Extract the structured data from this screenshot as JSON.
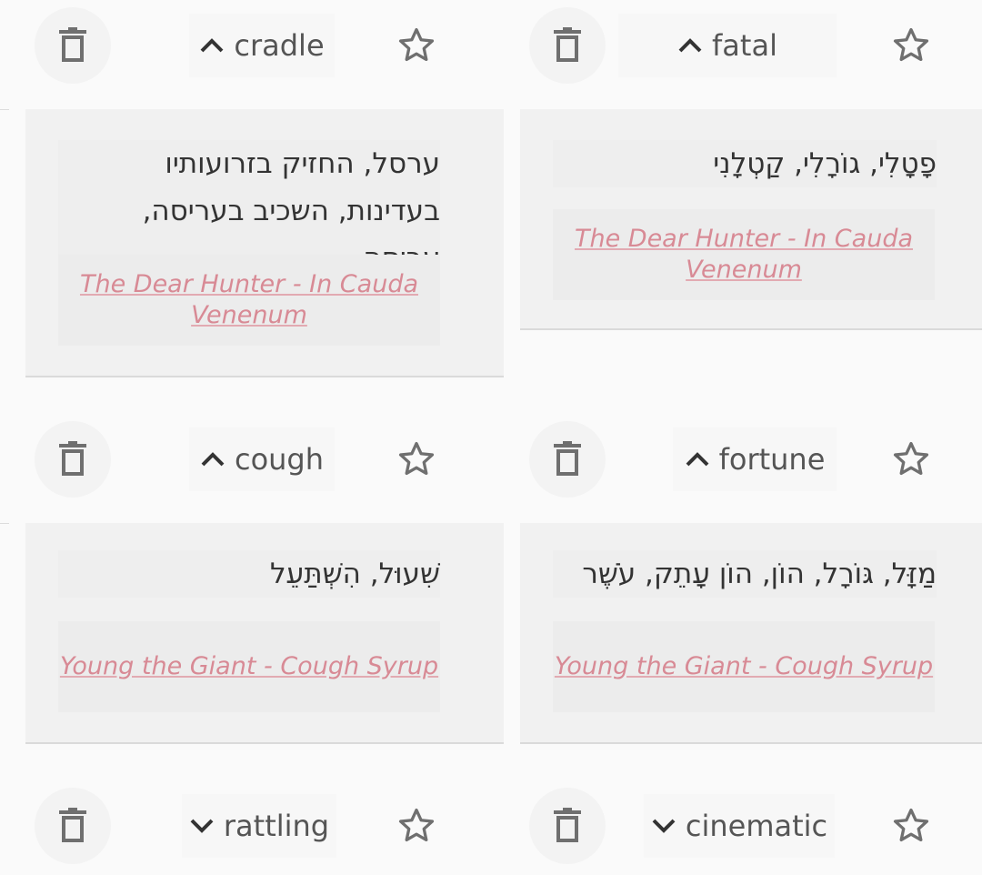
{
  "cards": [
    {
      "word": "cradle",
      "expanded": true,
      "translation": "ערסל, החזיק בזרועותיו בעדינות, השכיב בעריסה, עֲרִיסָה",
      "source": "The Dear Hunter - In Cauda Venenum"
    },
    {
      "word": "fatal",
      "expanded": true,
      "translation": "פָטָלִי, גוֹרָלִי, קַטְלָנִי",
      "source": "The Dear Hunter - In Cauda Venenum"
    },
    {
      "word": "cough",
      "expanded": true,
      "translation": "שִׁעוּל, הִשְׁתַּעֵל",
      "source": "Young the Giant - Cough Syrup"
    },
    {
      "word": "fortune",
      "expanded": true,
      "translation": "מַזָּל, גּוֹרָל, הוֹן, הוֹן עָתֵק, עֹשֶׁר",
      "source": "Young the Giant - Cough Syrup"
    },
    {
      "word": "rattling",
      "expanded": false
    },
    {
      "word": "cinematic",
      "expanded": false
    }
  ],
  "icons": {
    "delete": "trash-icon",
    "favorite": "star-outline-icon",
    "expanded": "chevron-up-icon",
    "collapsed": "chevron-down-icon"
  },
  "colors": {
    "source_link": "#d88a95",
    "icon": "#6f6f6f",
    "text": "#333333"
  }
}
